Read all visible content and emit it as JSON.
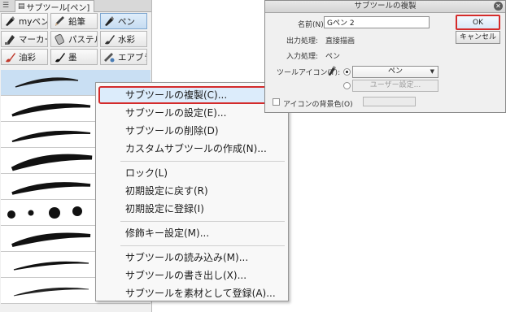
{
  "panel": {
    "tab_label": "サブツール[ペン]",
    "groups": [
      {
        "label": "myペン",
        "icon": "pen-nib-icon"
      },
      {
        "label": "鉛筆",
        "icon": "pencil-icon"
      },
      {
        "label": "ペン",
        "icon": "pen-nib-icon",
        "selected": true
      },
      {
        "label": "マーカー",
        "icon": "marker-icon"
      },
      {
        "label": "パステル",
        "icon": "pastel-icon"
      },
      {
        "label": "水彩",
        "icon": "brush-icon"
      },
      {
        "label": "油彩",
        "icon": "oil-brush-icon"
      },
      {
        "label": "墨",
        "icon": "ink-brush-icon"
      },
      {
        "label": "エアブラシ",
        "icon": "airbrush-icon"
      }
    ]
  },
  "context_menu": {
    "groups": [
      [
        "サブツールの複製(C)...",
        "サブツールの設定(E)...",
        "サブツールの削除(D)",
        "カスタムサブツールの作成(N)..."
      ],
      [
        "ロック(L)",
        "初期設定に戻す(R)",
        "初期設定に登録(I)"
      ],
      [
        "修飾キー設定(M)..."
      ],
      [
        "サブツールの読み込み(M)...",
        "サブツールの書き出し(X)...",
        "サブツールを素材として登録(A)..."
      ]
    ]
  },
  "dialog": {
    "title": "サブツールの複製",
    "name_label": "名前(N):",
    "name_value": "Gペン 2",
    "output_label": "出力処理:",
    "output_value": "直接描画",
    "input_label": "入力処理:",
    "input_value": "ペン",
    "icon_label": "ツールアイコン(T):",
    "icon_select_value": "ペン",
    "user_setting_label": "ユーザー設定...",
    "bgcolor_label": "アイコンの背景色(O)",
    "ok_label": "OK",
    "cancel_label": "キャンセル"
  },
  "colors": {
    "highlight_border": "#d42b2b",
    "selection": "#c9dff3"
  }
}
